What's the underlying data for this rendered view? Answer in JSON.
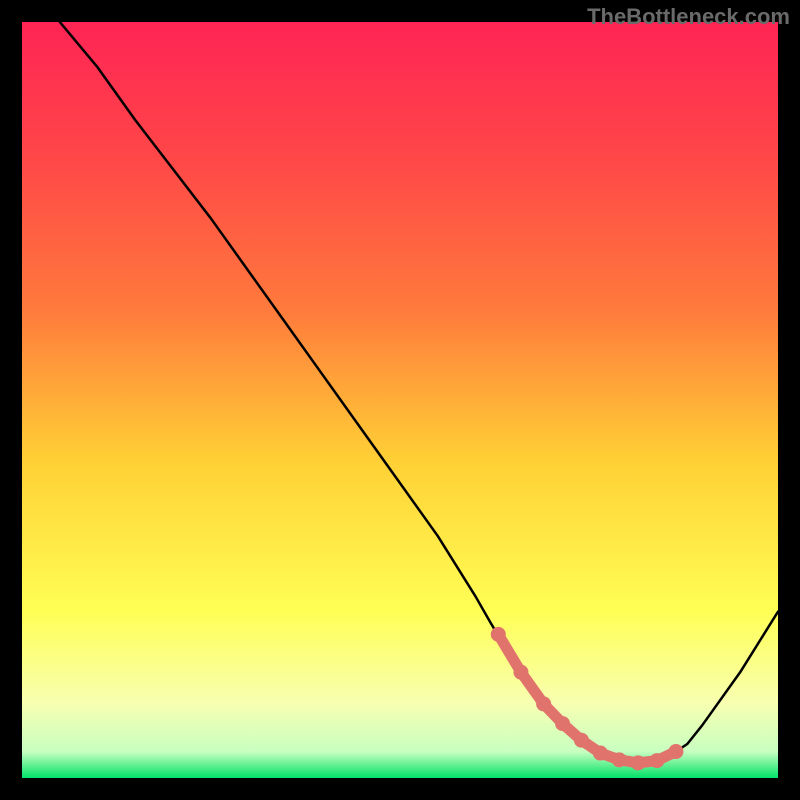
{
  "watermark": "TheBottleneck.com",
  "colors": {
    "background": "#000000",
    "gradient_top": "#ff2455",
    "gradient_mid_upper": "#ff7a3c",
    "gradient_mid": "#ffd035",
    "gradient_mid_lower": "#ffff55",
    "gradient_lower": "#f8ffb0",
    "gradient_bottom": "#00e268",
    "curve": "#000000",
    "marker": "#e1736d"
  },
  "chart_data": {
    "type": "line",
    "title": "",
    "xlabel": "",
    "ylabel": "",
    "xlim": [
      0,
      100
    ],
    "ylim": [
      0,
      100
    ],
    "grid": false,
    "legend": false,
    "series": [
      {
        "name": "curve",
        "x": [
          5,
          10,
          15,
          20,
          25,
          30,
          35,
          40,
          45,
          50,
          55,
          60,
          62,
          65,
          68,
          70,
          72,
          75,
          78,
          80,
          82,
          85,
          88,
          90,
          95,
          100
        ],
        "values": [
          100,
          94,
          87,
          80.5,
          74,
          67,
          60,
          53,
          46,
          39,
          32,
          24,
          20.5,
          15.5,
          11,
          8.5,
          6.5,
          4,
          2.6,
          2,
          2,
          2.5,
          4.5,
          7,
          14,
          22
        ]
      },
      {
        "name": "markers",
        "x": [
          63,
          66,
          69,
          71.5,
          74,
          76.5,
          79,
          81.5,
          84,
          86.5
        ],
        "values": [
          19,
          14,
          9.8,
          7.2,
          5,
          3.3,
          2.4,
          2,
          2.3,
          3.5
        ]
      }
    ]
  }
}
